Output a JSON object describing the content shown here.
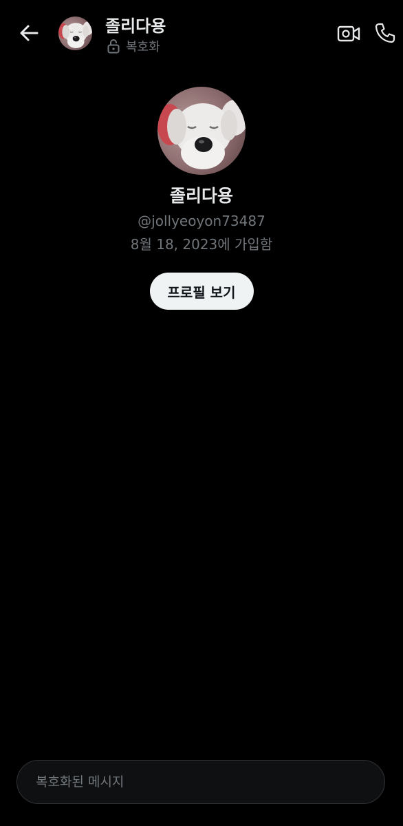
{
  "header": {
    "title": "졸리다용",
    "encryption_label": "복호화",
    "back_icon": "arrow-left-icon",
    "video_icon": "video-call-icon",
    "phone_icon": "phone-call-icon",
    "lock_icon": "unlock-icon"
  },
  "profile": {
    "name": "졸리다용",
    "handle": "@jollyeoyon73487",
    "joined": "8월 18, 2023에 가입함",
    "view_profile_label": "프로필 보기"
  },
  "composer": {
    "placeholder": "복호화된 메시지"
  },
  "colors": {
    "background": "#000000",
    "primary_text": "#e7e9ea",
    "secondary_text": "#71767b",
    "button_bg": "#eff3f4",
    "button_text": "#0f1419",
    "composer_border": "#2f3336"
  }
}
